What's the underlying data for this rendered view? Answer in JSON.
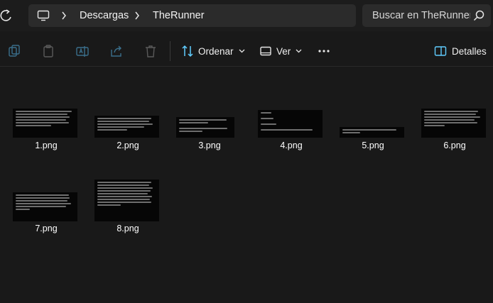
{
  "address_bar": {
    "breadcrumb": [
      "Descargas",
      "TheRunner"
    ],
    "search_placeholder": "Buscar en TheRunner"
  },
  "command_bar": {
    "sort_label": "Ordenar",
    "view_label": "Ver",
    "details_label": "Detalles",
    "icons": [
      "new-folder-icon",
      "copy-icon",
      "paste-icon",
      "rename-icon",
      "share-icon",
      "delete-icon",
      "sort-icon",
      "view-icon",
      "more-icon",
      "details-pane-icon"
    ]
  },
  "files": [
    {
      "name": "1.png"
    },
    {
      "name": "2.png"
    },
    {
      "name": "3.png"
    },
    {
      "name": "4.png"
    },
    {
      "name": "5.png"
    },
    {
      "name": "6.png"
    },
    {
      "name": "7.png"
    },
    {
      "name": "8.png"
    }
  ],
  "colors": {
    "background": "#191919",
    "field": "#2b2b2b",
    "text": "#ffffff",
    "accent": "#60cdff"
  }
}
